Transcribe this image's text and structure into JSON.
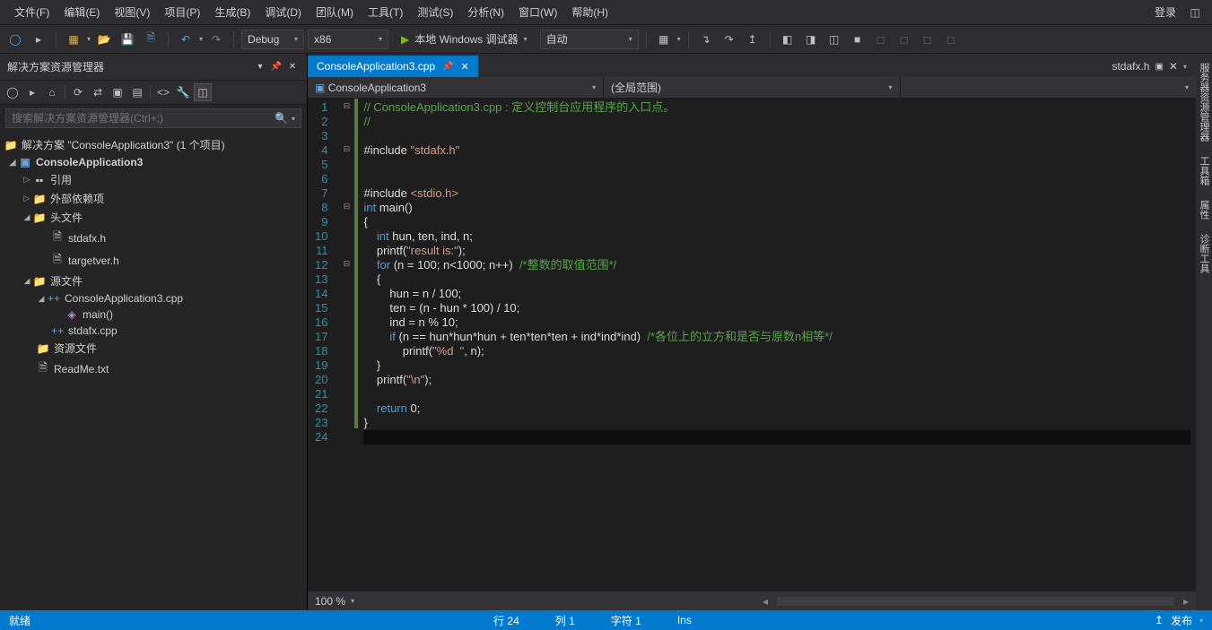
{
  "menus": [
    "文件(F)",
    "编辑(E)",
    "视图(V)",
    "项目(P)",
    "生成(B)",
    "调试(D)",
    "团队(M)",
    "工具(T)",
    "测试(S)",
    "分析(N)",
    "窗口(W)",
    "帮助(H)"
  ],
  "login": "登录",
  "toolbar": {
    "config": "Debug",
    "platform": "x86",
    "start_label": "本地 Windows 调试器",
    "start_mode": "自动"
  },
  "panel": {
    "title": "解决方案资源管理器",
    "search_placeholder": "搜索解决方案资源管理器(Ctrl+;)"
  },
  "tree": {
    "solution": "解决方案 \"ConsoleApplication3\" (1 个项目)",
    "project": "ConsoleApplication3",
    "refs": "引用",
    "extdeps": "外部依赖项",
    "headers": "头文件",
    "h1": "stdafx.h",
    "h2": "targetver.h",
    "sources": "源文件",
    "src1": "ConsoleApplication3.cpp",
    "src1_fn": "main()",
    "src2": "stdafx.cpp",
    "resources": "资源文件",
    "readme": "ReadMe.txt"
  },
  "tabs": {
    "active": "ConsoleApplication3.cpp",
    "right": "stdafx.h"
  },
  "nav": {
    "left": "ConsoleApplication3",
    "mid": "",
    "right": "(全局范围)"
  },
  "code": {
    "lines": [
      {
        "n": 1,
        "fold": "⊟",
        "mark": true,
        "segs": [
          {
            "t": "// ConsoleApplication3.cpp : 定义控制台应用程序的入口点。",
            "c": "tok-comment"
          }
        ]
      },
      {
        "n": 2,
        "mark": true,
        "segs": [
          {
            "t": "//",
            "c": "tok-comment"
          }
        ]
      },
      {
        "n": 3,
        "mark": true,
        "segs": []
      },
      {
        "n": 4,
        "fold": "⊟",
        "mark": true,
        "segs": [
          {
            "t": "#include ",
            "c": "tok-brace"
          },
          {
            "t": "\"stdafx.h\"",
            "c": "tok-string"
          }
        ]
      },
      {
        "n": 5,
        "mark": true,
        "segs": []
      },
      {
        "n": 6,
        "mark": true,
        "segs": []
      },
      {
        "n": 7,
        "mark": true,
        "segs": [
          {
            "t": "#include ",
            "c": "tok-brace"
          },
          {
            "t": "<stdio.h>",
            "c": "tok-string"
          }
        ]
      },
      {
        "n": 8,
        "fold": "⊟",
        "mark": true,
        "segs": [
          {
            "t": "int",
            "c": "tok-keyword"
          },
          {
            "t": " main()",
            "c": "tok-brace"
          }
        ]
      },
      {
        "n": 9,
        "mark": true,
        "segs": [
          {
            "t": "{",
            "c": "tok-brace"
          }
        ]
      },
      {
        "n": 10,
        "mark": true,
        "segs": [
          {
            "t": "    ",
            "c": ""
          },
          {
            "t": "int",
            "c": "tok-keyword"
          },
          {
            "t": " hun, ten, ind, n;",
            "c": "tok-brace"
          }
        ]
      },
      {
        "n": 11,
        "mark": true,
        "segs": [
          {
            "t": "    printf(",
            "c": "tok-brace"
          },
          {
            "t": "\"result is:\"",
            "c": "tok-string"
          },
          {
            "t": ");",
            "c": "tok-brace"
          }
        ]
      },
      {
        "n": 12,
        "fold": "⊟",
        "mark": true,
        "segs": [
          {
            "t": "    ",
            "c": ""
          },
          {
            "t": "for",
            "c": "tok-keyword"
          },
          {
            "t": " (n = 100; n<1000; n++)  ",
            "c": "tok-brace"
          },
          {
            "t": "/*整数的取值范围*/",
            "c": "tok-comment"
          }
        ]
      },
      {
        "n": 13,
        "mark": true,
        "segs": [
          {
            "t": "    {",
            "c": "tok-brace"
          }
        ]
      },
      {
        "n": 14,
        "mark": true,
        "segs": [
          {
            "t": "        hun = n / 100;",
            "c": "tok-brace"
          }
        ]
      },
      {
        "n": 15,
        "mark": true,
        "segs": [
          {
            "t": "        ten = (n - hun * 100) / 10;",
            "c": "tok-brace"
          }
        ]
      },
      {
        "n": 16,
        "mark": true,
        "segs": [
          {
            "t": "        ind = n % 10;",
            "c": "tok-brace"
          }
        ]
      },
      {
        "n": 17,
        "mark": true,
        "segs": [
          {
            "t": "        ",
            "c": ""
          },
          {
            "t": "if",
            "c": "tok-keyword"
          },
          {
            "t": " (n == hun*hun*hun + ten*ten*ten + ind*ind*ind)  ",
            "c": "tok-brace"
          },
          {
            "t": "/*各位上的立方和是否与原数n相等*/",
            "c": "tok-comment"
          }
        ]
      },
      {
        "n": 18,
        "mark": true,
        "segs": [
          {
            "t": "            printf(",
            "c": "tok-brace"
          },
          {
            "t": "\"%d  \"",
            "c": "tok-string"
          },
          {
            "t": ", n);",
            "c": "tok-brace"
          }
        ]
      },
      {
        "n": 19,
        "mark": true,
        "segs": [
          {
            "t": "    }",
            "c": "tok-brace"
          }
        ]
      },
      {
        "n": 20,
        "mark": true,
        "segs": [
          {
            "t": "    printf(",
            "c": "tok-brace"
          },
          {
            "t": "\"\\n\"",
            "c": "tok-string"
          },
          {
            "t": ");",
            "c": "tok-brace"
          }
        ]
      },
      {
        "n": 21,
        "mark": true,
        "segs": []
      },
      {
        "n": 22,
        "mark": true,
        "segs": [
          {
            "t": "    ",
            "c": ""
          },
          {
            "t": "return",
            "c": "tok-keyword"
          },
          {
            "t": " 0;",
            "c": "tok-brace"
          }
        ]
      },
      {
        "n": 23,
        "mark": true,
        "segs": [
          {
            "t": "}",
            "c": "tok-brace"
          }
        ]
      },
      {
        "n": 24,
        "current": true,
        "segs": []
      }
    ]
  },
  "editor_status": {
    "zoom": "100 %"
  },
  "right_tabs": [
    "服务器资源管理器",
    "工具箱",
    "属性",
    "诊断工具"
  ],
  "statusbar": {
    "ready": "就绪",
    "line": "行 24",
    "col": "列 1",
    "char": "字符 1",
    "ins": "Ins",
    "publish": "发布"
  }
}
